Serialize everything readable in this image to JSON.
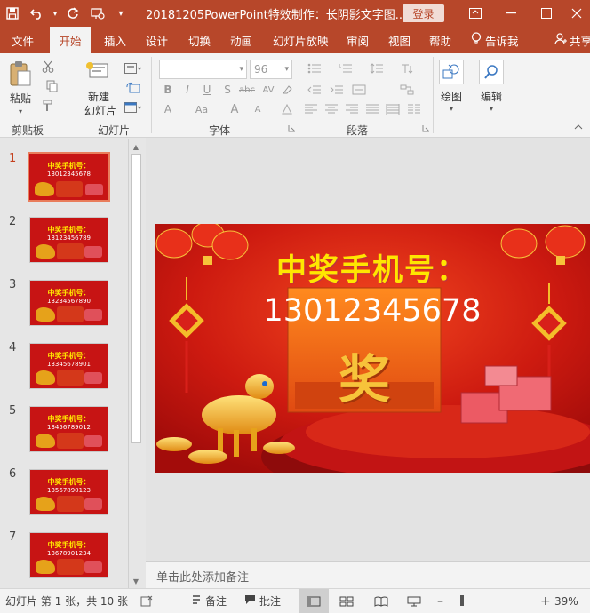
{
  "titlebar": {
    "title": "20181205PowerPoint特效制作：长阴影文字图...",
    "login_label": "登录",
    "save_icon": "save-icon",
    "undo_icon": "undo-icon",
    "redo_icon": "redo-icon",
    "present_icon": "present-from-start-icon",
    "customize_label": "▾"
  },
  "tabs": [
    "文件",
    "开始",
    "插入",
    "设计",
    "切换",
    "动画",
    "幻灯片放映",
    "审阅",
    "视图",
    "帮助"
  ],
  "tell_me": "告诉我",
  "share": "共享",
  "ribbon": {
    "paste_label": "粘贴",
    "new_slide_label_1": "新建",
    "new_slide_label_2": "幻灯片",
    "drawing_label": "绘图",
    "editing_label": "编辑",
    "font_size": "96",
    "groups": {
      "clipboard": "剪贴板",
      "slides": "幻灯片",
      "font": "字体",
      "paragraph": "段落"
    },
    "font_buttons": [
      "B",
      "I",
      "U",
      "S",
      "abc",
      "AV",
      "Aa",
      "A",
      "A"
    ]
  },
  "slides": [
    {
      "num": "1",
      "title": "中奖手机号：",
      "phone": "13012345678"
    },
    {
      "num": "2",
      "title": "中奖手机号：",
      "phone": "13123456789"
    },
    {
      "num": "3",
      "title": "中奖手机号：",
      "phone": "13234567890"
    },
    {
      "num": "4",
      "title": "中奖手机号：",
      "phone": "13345678901"
    },
    {
      "num": "5",
      "title": "中奖手机号：",
      "phone": "13456789012"
    },
    {
      "num": "6",
      "title": "中奖手机号：",
      "phone": "13567890123"
    },
    {
      "num": "7",
      "title": "中奖手机号：",
      "phone": "13678901234"
    }
  ],
  "main_slide": {
    "title": "中奖手机号：",
    "phone": "13012345678",
    "prize_char": "奖"
  },
  "notes_placeholder": "单击此处添加备注",
  "status": {
    "slide_info": "幻灯片 第 1 张，共 10 张",
    "notes_label": "备注",
    "comments_label": "批注",
    "zoom": "39%",
    "minus": "–",
    "plus": "+"
  }
}
